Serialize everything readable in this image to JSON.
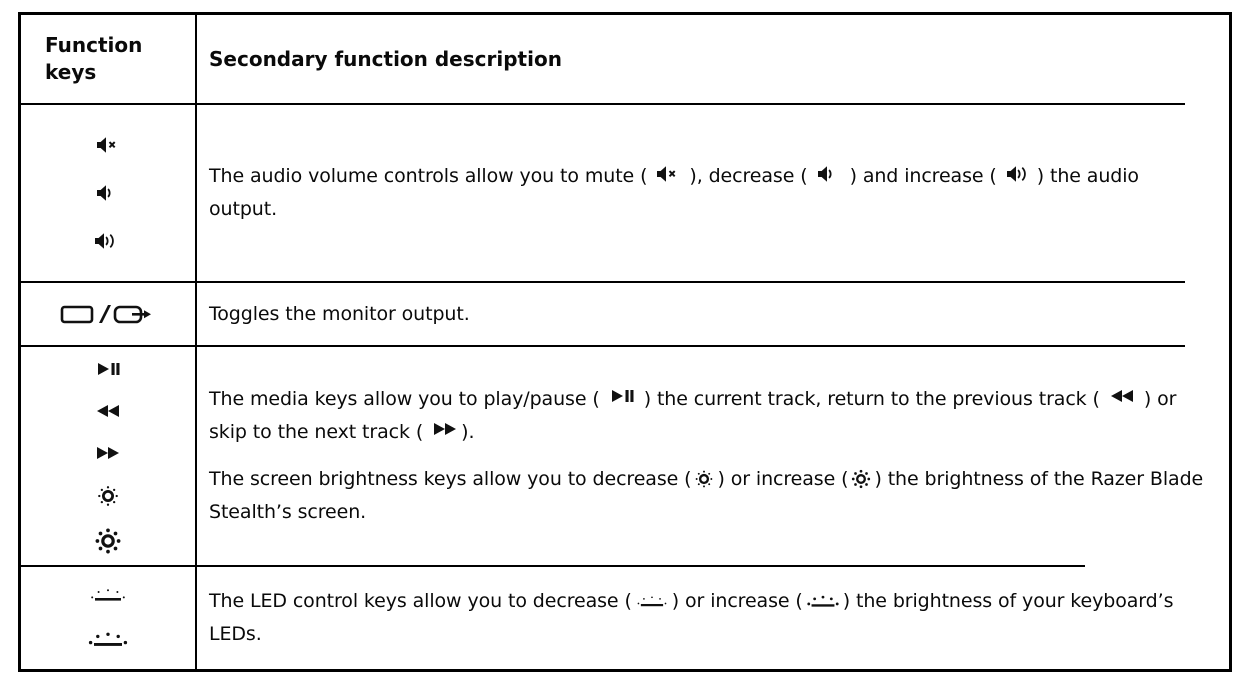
{
  "table": {
    "headers": {
      "keys_line1": "Function",
      "keys_line2": "keys",
      "description": "Secondary function description"
    },
    "rows": [
      {
        "id": "audio-volume",
        "keys": [
          "volume-mute-icon",
          "volume-low-icon",
          "volume-high-icon"
        ],
        "paragraphs": [
          {
            "segments": [
              {
                "type": "text",
                "value": "The audio volume controls allow you to mute ("
              },
              {
                "type": "icon",
                "value": "volume-mute-icon"
              },
              {
                "type": "text",
                "value": "), decrease ("
              },
              {
                "type": "icon",
                "value": "volume-low-icon"
              },
              {
                "type": "text",
                "value": ") and increase ("
              },
              {
                "type": "icon",
                "value": "volume-high-icon"
              },
              {
                "type": "text",
                "value": ") the audio output."
              }
            ],
            "plain": "The audio volume controls allow you to mute ( ), decrease ( ) and increase ( ) the audio output."
          }
        ]
      },
      {
        "id": "monitor-output",
        "keys": [
          "monitor-toggle-icon"
        ],
        "paragraphs": [
          {
            "segments": [
              {
                "type": "text",
                "value": "Toggles the monitor output."
              }
            ],
            "plain": "Toggles the monitor output."
          }
        ]
      },
      {
        "id": "media-and-brightness",
        "keys": [
          "play-pause-icon",
          "rewind-icon",
          "fast-forward-icon",
          "brightness-down-icon",
          "brightness-up-icon"
        ],
        "paragraphs": [
          {
            "segments": [
              {
                "type": "text",
                "value": "The media keys allow you to play/pause ("
              },
              {
                "type": "icon",
                "value": "play-pause-icon"
              },
              {
                "type": "text",
                "value": ") the current track, return to the previous track ("
              },
              {
                "type": "icon",
                "value": "rewind-icon"
              },
              {
                "type": "text",
                "value": ") or skip to the next track ("
              },
              {
                "type": "icon",
                "value": "fast-forward-icon"
              },
              {
                "type": "text",
                "value": ")."
              }
            ],
            "plain": "The media keys allow you to play/pause ( ) the current track, return to the previous track ( ) or skip to the next track ( )."
          },
          {
            "segments": [
              {
                "type": "text",
                "value": "The screen brightness keys allow you to decrease ("
              },
              {
                "type": "icon",
                "value": "brightness-down-icon"
              },
              {
                "type": "text",
                "value": ") or increase ("
              },
              {
                "type": "icon",
                "value": "brightness-up-icon"
              },
              {
                "type": "text",
                "value": ") the brightness of the Razer Blade Stealth’s screen."
              }
            ],
            "plain": "The screen brightness keys allow you to decrease ( ) or increase ( ) the brightness of the Razer Blade Stealth’s screen."
          }
        ]
      },
      {
        "id": "led-control",
        "keys": [
          "led-brightness-down-icon",
          "led-brightness-up-icon"
        ],
        "paragraphs": [
          {
            "segments": [
              {
                "type": "text",
                "value": "The LED control keys allow you to decrease ("
              },
              {
                "type": "icon",
                "value": "led-brightness-down-icon"
              },
              {
                "type": "text",
                "value": ") or increase ("
              },
              {
                "type": "icon",
                "value": "led-brightness-up-icon"
              },
              {
                "type": "text",
                "value": ") the brightness of your keyboard’s LEDs."
              }
            ],
            "plain": "The LED control keys allow you to decrease ( ) or increase ( ) the brightness of your keyboard’s LEDs."
          }
        ]
      }
    ]
  },
  "colors": {
    "border": "#000000",
    "text": "#0a0a0a",
    "background": "#ffffff",
    "icon": "#111111"
  },
  "text_fragments": {
    "audio_p1_a": "The audio volume controls allow you to mute (",
    "audio_p1_b": "), decrease (",
    "audio_p1_c": ") and increase (",
    "audio_p1_d": ") the audio output.",
    "monitor_p1": "Toggles the monitor output.",
    "media_p1_a": "The media keys allow you to play/pause (",
    "media_p1_b": ") the current track, return to the previous track (",
    "media_p1_c": ") or skip to the next track (",
    "media_p1_d": ").",
    "bright_p1_a": "The screen brightness keys allow you to decrease (",
    "bright_p1_b": ") or increase (",
    "bright_p1_c": ") the brightness of the Razer Blade Stealth’s screen.",
    "led_p1_a": "The LED control keys allow you to decrease (",
    "led_p1_b": ") or increase (",
    "led_p1_c": ") the brightness of your keyboard’s LEDs."
  }
}
